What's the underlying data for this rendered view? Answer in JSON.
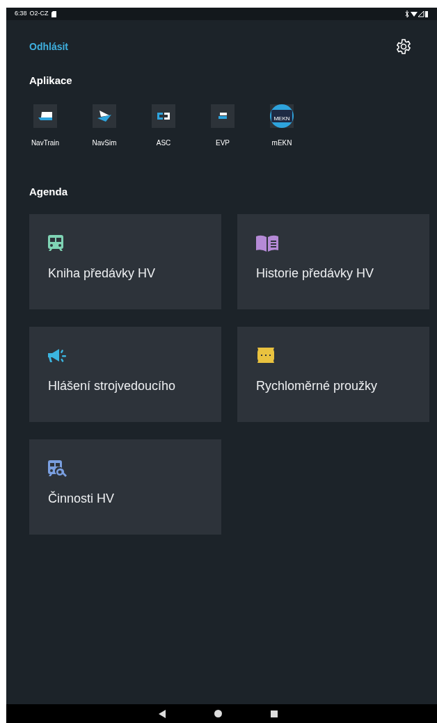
{
  "status_bar": {
    "time": "6:38",
    "carrier": "O2-CZ"
  },
  "header": {
    "logout": "Odhlásit"
  },
  "apps_section": {
    "title": "Aplikace",
    "apps": [
      {
        "label": "NavTrain",
        "kind": "navtrain"
      },
      {
        "label": "NavSim",
        "kind": "navsim"
      },
      {
        "label": "ASC",
        "kind": "asc"
      },
      {
        "label": "EVP",
        "kind": "evp"
      },
      {
        "label": "mEKN",
        "kind": "mekn",
        "badge": "MEKN"
      }
    ]
  },
  "agenda_section": {
    "title": "Agenda",
    "items": [
      {
        "label": "Kniha předávky HV",
        "kind": "train",
        "color": "#7fd3b4"
      },
      {
        "label": "Historie předávky HV",
        "kind": "book",
        "color": "#b58ad6"
      },
      {
        "label": "Hlášení strojvedoucího",
        "kind": "megaphone",
        "color": "#3bb5e0"
      },
      {
        "label": "Rychloměrné proužky",
        "kind": "strip",
        "color": "#e9c23f"
      },
      {
        "label": "Činnosti HV",
        "kind": "train-search",
        "color": "#7a9fe0"
      }
    ]
  }
}
